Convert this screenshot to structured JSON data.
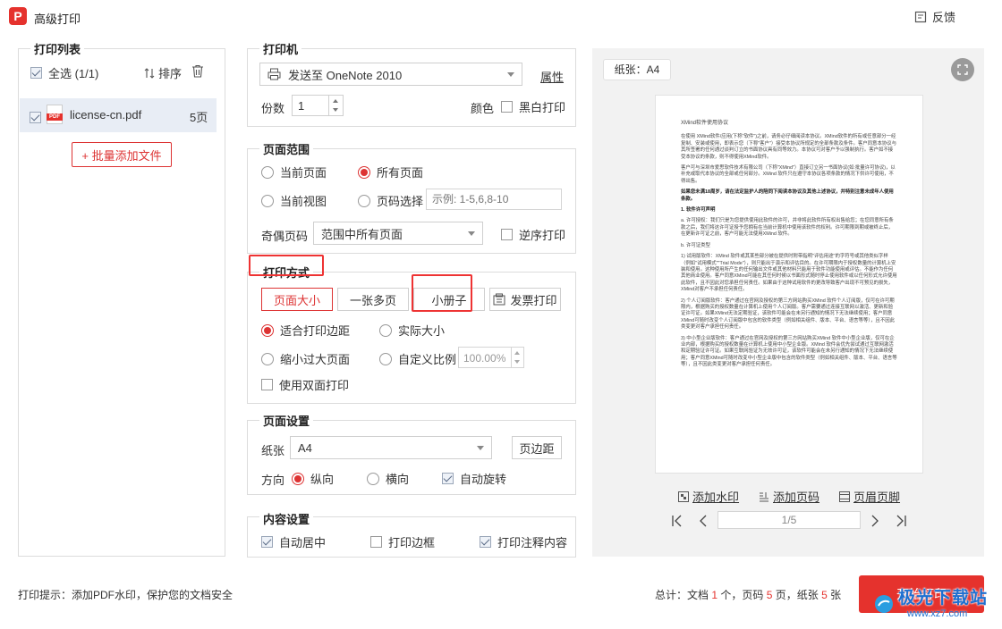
{
  "window": {
    "title": "高级打印",
    "logo_letter": "P",
    "feedback": "反馈"
  },
  "print_list": {
    "title": "打印列表",
    "select_all": "全选 (1/1)",
    "sort": "排序",
    "file_icon_text": "PDF",
    "file": {
      "name": "license-cn.pdf",
      "pages": "5页"
    },
    "add_files": "+ 批量添加文件"
  },
  "printer": {
    "title": "打印机",
    "selected": "发送至 OneNote 2010",
    "properties": "属性",
    "copies_label": "份数",
    "copies": "1",
    "color_label": "颜色",
    "bw_print": "黑白打印"
  },
  "page_range": {
    "title": "页面范围",
    "current_page": "当前页面",
    "all_pages": "所有页面",
    "current_view": "当前视图",
    "page_select": "页码选择",
    "page_select_placeholder": "示例: 1-5,6,8-10",
    "odd_even_label": "奇偶页码",
    "odd_even_value": "范围中所有页面",
    "reverse": "逆序打印"
  },
  "print_mode": {
    "title": "打印方式",
    "tabs": [
      "页面大小",
      "一张多页",
      "小册子",
      "发票打印"
    ],
    "fit_margins": "适合打印边距",
    "actual_size": "实际大小",
    "shrink_large": "缩小过大页面",
    "custom_scale": "自定义比例",
    "scale_value": "100.00%",
    "duplex": "使用双面打印"
  },
  "page_setup": {
    "title": "页面设置",
    "paper_label": "纸张",
    "paper_value": "A4",
    "margins": "页边距",
    "orientation_label": "方向",
    "portrait": "纵向",
    "landscape": "横向",
    "auto_rotate": "自动旋转"
  },
  "content_setup": {
    "title": "内容设置",
    "auto_center": "自动居中",
    "print_border": "打印边框",
    "print_annotations": "打印注释内容"
  },
  "preview": {
    "paper_badge": "纸张：A4",
    "add_watermark": "添加水印",
    "add_page_number": "添加页码",
    "header_footer": "页眉页脚",
    "page_indicator": "1/5",
    "doc": {
      "title": "XMind软件使用协议",
      "p1": "在使用 XMind软件/应用(下称\"软件\")之前，请务必仔细阅读本协议。XMind软件的所有或任意部分一经复制、安装或使用，即表示您（下称\"客户\"）接受本协议所规定的全部条款及条件。客户同意本协议与其所签署的任何通过谈判订立的书面协议具有同等效力。本协议可对客户予以强制执行。客户如不接受本协议的条款，则不得使用XMind软件。",
      "p2": "客户可与深圳市爱思软件技术有限公司（下称\"XMind\"）直接订立另一书面协议(如:批量许可协议)，以补充或取代本协议的全部或任何部分。XMind 软件只在遵守本协议各项条款的情况下供许可使用，不得出售。",
      "p3": "如果您未满18周岁，请在法定监护人的陪同下阅读本协议及其他上述协议，并特别注意未成年人使用条款。",
      "h1": "1. 软件许可声明",
      "p4": "a. 许可授权：我们只是为您提供使用此软件的许可，并非将此软件所有权出售给您；在您同意所有条款之后，我们将这许可证授予您拥有在当前计算机中使用该软件的权利。许可期限到期或被终止后，在更新许可证之前，客户可能无法使用XMind 软件。",
      "h2": "b. 许可证类型",
      "p5": "1) 试用版软件：XMind 软件或其某些部分被在提供时附带指明\"评估用途\"的字符号或其他类似字样（例如\"试用模式\"\"Trial Mode\"），则只能出于演示和评估目的。在许可期限内于授权数量的计算机上安装和使用。这种使用所产生的任何输出文件或其他材料只能用于软件功能使用或评估。不能作为任何其他商业使用。客户同意XMind可能在其任何时候以书面形式随时停止使用软件或以任何形式允许使用此软件，且不因此对您承担任何责任。如果由于这种试用软件的更改导致客户出现不可预见的损失，XMind对客户不承担任何责任。",
      "p6": "2) 个人订阅版软件：客户通过在官网及授权的第三方网站购买XMind 软件个人订阅版，仅可在许可期限内，根据购买的授权数量在计算机上使用个人订阅版。客户需要通过连接互联网以激活、更新和验证许可证。如果XMind无法定期验证，该软件可能会在未另行通知的情况下无法继续使用；客户同意XMind可随时改变个人订阅版中包含的软件类型（例如相关组件、版本、平台、语言等等），且不因此类变更对客户承担任何责任。",
      "p7": "3) 中小型企业版软件：客户通过在官网及授权的第三方网站购买XMind 软件中小型企业版，仅可在企业内部，根据购买的授权数量在计算机上使用中小型企业版。XMind 软件会优先尝试通过互联网激活和定期验证许可证。如果互联网验证为无效许可证，该软件可能会在未另行通知的情况下无法继续使用；客户同意XMind可随时改变中小型企业版中包含的软件类型（例如相关组件、版本、平台、语言等等），且不因此类变更对客户承担任何责任。"
    }
  },
  "footer": {
    "hint": "打印提示：添加PDF水印，保护您的文档安全",
    "sum_docs_pre": "总计：文档 ",
    "sum_docs": "1",
    "sum_docs_post": " 个，页码 ",
    "sum_pages": "5",
    "sum_pages_post": " 页，纸张 ",
    "sum_paper": "5",
    "sum_paper_post": " 张",
    "print_button": "开始打印",
    "watermark_text": "极光下载站",
    "watermark_url": "www.xz7.com"
  },
  "colors": {
    "accent": "#e5322d",
    "selected_bg": "#e8edf5",
    "highlight_box": "#ee3333"
  }
}
